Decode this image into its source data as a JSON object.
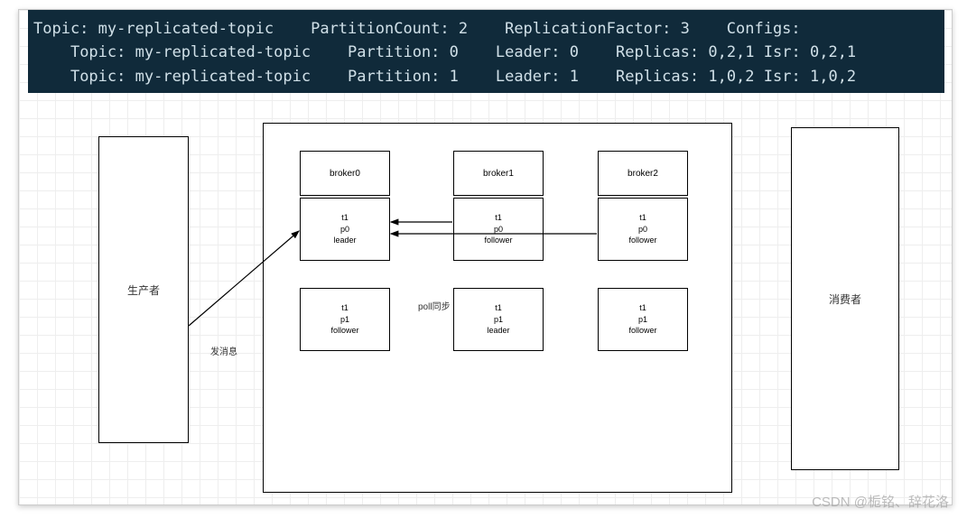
{
  "terminal": {
    "line1": {
      "topic_label": "Topic:",
      "topic_name": "my-replicated-topic",
      "partition_count_label": "PartitionCount:",
      "partition_count": "2",
      "replication_factor_label": "ReplicationFactor:",
      "replication_factor": "3",
      "configs_label": "Configs:"
    },
    "line2": {
      "topic_label": "Topic:",
      "topic_name": "my-replicated-topic",
      "partition_label": "Partition:",
      "partition": "0",
      "leader_label": "Leader:",
      "leader": "0",
      "replicas_label": "Replicas:",
      "replicas": "0,2,1",
      "isr_label": "Isr:",
      "isr": "0,2,1"
    },
    "line3": {
      "topic_label": "Topic:",
      "topic_name": "my-replicated-topic",
      "partition_label": "Partition:",
      "partition": "1",
      "leader_label": "Leader:",
      "leader": "1",
      "replicas_label": "Replicas:",
      "replicas": "1,0,2",
      "isr_label": "Isr:",
      "isr": "1,0,2"
    }
  },
  "diagram": {
    "producer": "生产者",
    "consumer": "消费者",
    "send_label": "发消息",
    "poll_label": "poll同步",
    "brokers": {
      "b0": {
        "header": "broker0",
        "p0": {
          "l1": "t1",
          "l2": "p0",
          "l3": "leader"
        },
        "p1": {
          "l1": "t1",
          "l2": "p1",
          "l3": "follower"
        }
      },
      "b1": {
        "header": "broker1",
        "p0": {
          "l1": "t1",
          "l2": "p0",
          "l3": "follower"
        },
        "p1": {
          "l1": "t1",
          "l2": "p1",
          "l3": "leader"
        }
      },
      "b2": {
        "header": "broker2",
        "p0": {
          "l1": "t1",
          "l2": "p0",
          "l3": "follower"
        },
        "p1": {
          "l1": "t1",
          "l2": "p1",
          "l3": "follower"
        }
      }
    }
  },
  "watermark": "CSDN @栀铭、辞花洛"
}
